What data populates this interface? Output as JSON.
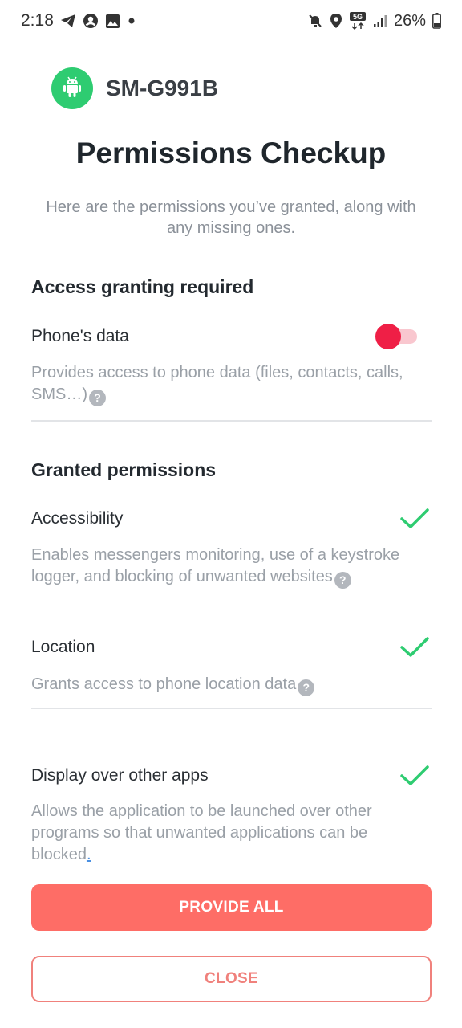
{
  "status_bar": {
    "time": "2:18",
    "battery": "26%",
    "network": "5G"
  },
  "device": {
    "name": "SM-G991B",
    "icon": "android-icon",
    "avatar_color": "#2ecc71"
  },
  "header": {
    "title": "Permissions Checkup",
    "subtitle": "Here are the permissions you’ve granted, along with any missing ones."
  },
  "required_section": {
    "title": "Access granting required",
    "items": [
      {
        "name": "Phone's data",
        "description": "Provides access to phone data (files, contacts, calls, SMS…)",
        "toggle_state": "off"
      }
    ]
  },
  "granted_section": {
    "title": "Granted permissions",
    "items": [
      {
        "name": "Accessibility",
        "description": "Enables messengers monitoring, use of a keystroke logger, and blocking of unwanted websites"
      },
      {
        "name": "Location",
        "description": "Grants access to phone location data"
      },
      {
        "name": "Display over other apps",
        "description": "Allows the application to be launched over other programs so that unwanted applications can be blocked",
        "link_text": "."
      }
    ]
  },
  "actions": {
    "provide_all": "PROVIDE ALL",
    "close": "CLOSE"
  },
  "colors": {
    "accent": "#fe6d66",
    "toggle_knob": "#ef1f46",
    "check": "#2ecc71"
  }
}
